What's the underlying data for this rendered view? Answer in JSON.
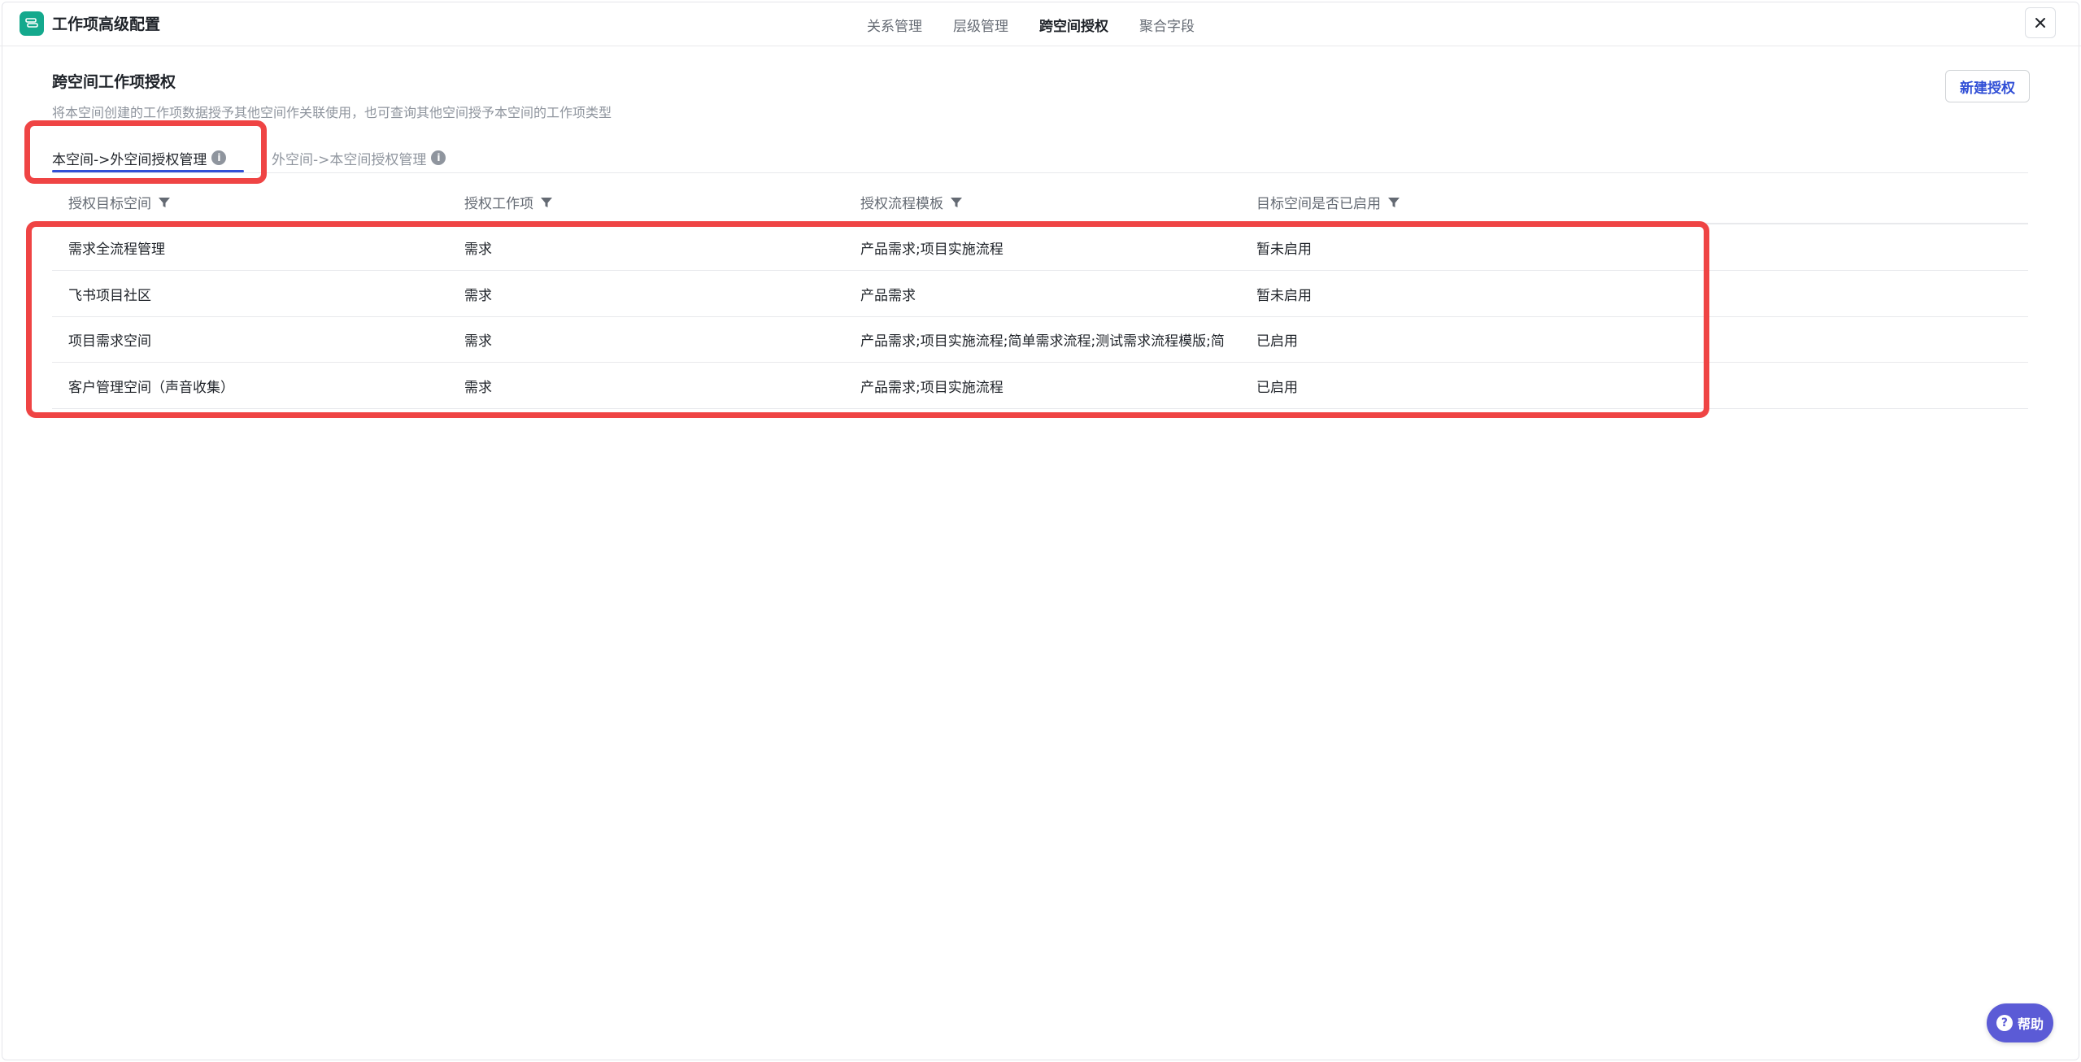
{
  "header": {
    "title": "工作项高级配置",
    "tabs": [
      {
        "label": "关系管理"
      },
      {
        "label": "层级管理"
      },
      {
        "label": "跨空间授权"
      },
      {
        "label": "聚合字段"
      }
    ],
    "active_tab": "跨空间授权"
  },
  "section": {
    "title": "跨空间工作项授权",
    "description": "将本空间创建的工作项数据授予其他空间作关联使用，也可查询其他空间授予本空间的工作项类型",
    "new_button": "新建授权"
  },
  "subtabs": [
    {
      "label": "本空间->外空间授权管理",
      "info": "i"
    },
    {
      "label": "外空间->本空间授权管理",
      "info": "i"
    }
  ],
  "table": {
    "columns": [
      "授权目标空间",
      "授权工作项",
      "授权流程模板",
      "目标空间是否已启用"
    ],
    "rows": [
      {
        "space": "需求全流程管理",
        "item": "需求",
        "template": "产品需求;项目实施流程",
        "status": "暂未启用"
      },
      {
        "space": "飞书项目社区",
        "item": "需求",
        "template": "产品需求",
        "status": "暂未启用"
      },
      {
        "space": "项目需求空间",
        "item": "需求",
        "template": "产品需求;项目实施流程;简单需求流程;测试需求流程模版;简",
        "status": "已启用"
      },
      {
        "space": "客户管理空间（声音收集）",
        "item": "需求",
        "template": "产品需求;项目实施流程",
        "status": "已启用"
      }
    ]
  },
  "help": {
    "label": "帮助",
    "icon": "?"
  },
  "colors": {
    "accent": "#3250d6",
    "brand": "#14a98d",
    "highlight": "#ef4444",
    "help": "#5b5bd6"
  }
}
